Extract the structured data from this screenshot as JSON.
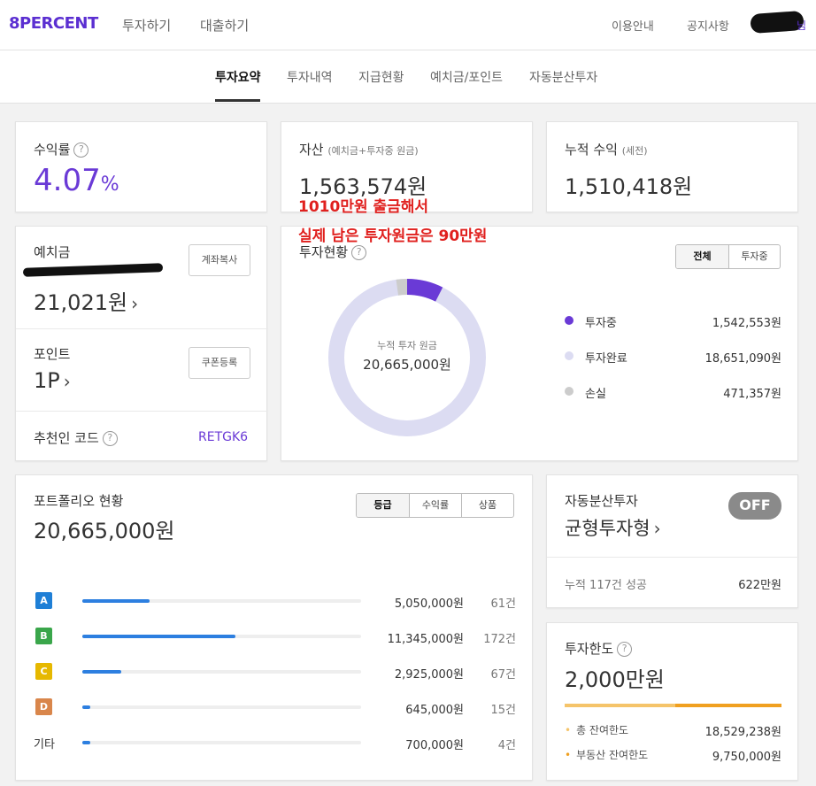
{
  "header": {
    "logo": "8PERCENT",
    "nav": [
      "투자하기",
      "대출하기"
    ],
    "right_nav": [
      "이용안내",
      "공지사항"
    ],
    "user_fragment": "님"
  },
  "subnav": {
    "tabs": [
      "투자요약",
      "투자내역",
      "지급현황",
      "예치금/포인트",
      "자동분산투자"
    ],
    "active": "투자요약"
  },
  "summary": {
    "yield": {
      "label": "수익률",
      "value": "4.07",
      "unit": "%"
    },
    "assets": {
      "label": "자산",
      "sublabel": "(예치금+투자중 원금)",
      "value": "1,563,574원"
    },
    "cumulative": {
      "label": "누적 수익",
      "sublabel": "(세전)",
      "value": "1,510,418원"
    }
  },
  "annotation": {
    "line1": "1010만원 출금해서",
    "line2": "실제 남은 투자원금은 90만원"
  },
  "deposit": {
    "label": "예치금",
    "value": "21,021원",
    "copy_button": "계좌복사",
    "point_label": "포인트",
    "point_value": "1P",
    "coupon_button": "쿠폰등록",
    "referral_label": "추천인 코드",
    "referral_code": "RETGK6"
  },
  "investment_status": {
    "label": "투자현황",
    "filters": [
      "전체",
      "투자중"
    ],
    "center_label": "누적 투자 원금",
    "center_value": "20,665,000원",
    "legend": [
      {
        "label": "투자중",
        "value": "1,542,553원",
        "color": "#6a3ad6"
      },
      {
        "label": "투자완료",
        "value": "18,651,090원",
        "color": "#dcdcf2"
      },
      {
        "label": "손실",
        "value": "471,357원",
        "color": "#cccccc"
      }
    ]
  },
  "portfolio": {
    "label": "포트폴리오 현황",
    "total": "20,665,000원",
    "filters": [
      "등급",
      "수익률",
      "상품"
    ],
    "rows": [
      {
        "grade": "A",
        "color": "#1f7fd6",
        "amount": "5,050,000원",
        "count": "61건",
        "fraction": 0.24
      },
      {
        "grade": "B",
        "color": "#3aa64b",
        "amount": "11,345,000원",
        "count": "172건",
        "fraction": 0.55
      },
      {
        "grade": "C",
        "color": "#e6b800",
        "amount": "2,925,000원",
        "count": "67건",
        "fraction": 0.14
      },
      {
        "grade": "D",
        "color": "#d9864b",
        "amount": "645,000원",
        "count": "15건",
        "fraction": 0.03
      },
      {
        "grade": "기타",
        "color": "",
        "amount": "700,000원",
        "count": "4건",
        "fraction": 0.03
      }
    ]
  },
  "auto_invest": {
    "label": "자동분산투자",
    "toggle": "OFF",
    "type": "균형투자형",
    "stat_label": "누적 117건 성공",
    "stat_value": "622만원"
  },
  "limit": {
    "label": "투자한도",
    "value": "2,000만원",
    "rows": [
      {
        "label": "총 잔여한도",
        "value": "18,529,238원",
        "color": "#f5c46a",
        "fraction": 0.93
      },
      {
        "label": "부동산 잔여한도",
        "value": "9,750,000원",
        "color": "#f0a020",
        "fraction": 0.49
      }
    ]
  }
}
